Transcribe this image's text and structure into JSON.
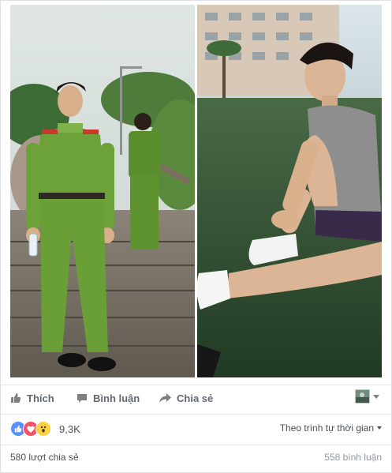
{
  "actions": {
    "like": "Thích",
    "comment": "Bình luận",
    "share": "Chia sẻ"
  },
  "reactions": {
    "count": "9,3K",
    "types": [
      "like",
      "love",
      "wow"
    ]
  },
  "sort": {
    "label": "Theo trình tự thời gian"
  },
  "footer": {
    "shares": "580 lượt chia sẻ",
    "comments": "558 bình luận"
  },
  "colors": {
    "like": "#5890ff",
    "love": "#f25268",
    "wow": "#fcd244",
    "action_text": "#616770"
  },
  "icons": [
    "like-icon",
    "comment-icon",
    "share-icon",
    "caret-down-icon"
  ]
}
